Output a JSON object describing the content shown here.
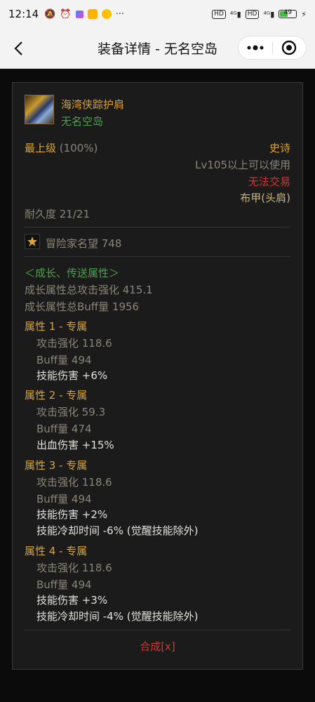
{
  "status_bar": {
    "time": "12:14",
    "battery": "49"
  },
  "header": {
    "title": "装备详情 - 无名空岛"
  },
  "item": {
    "name": "海湾侠踪护肩",
    "source": "无名空岛",
    "grade_label": "最上级",
    "grade_pct": "(100%)",
    "rarity": "史诗",
    "level_req": "Lv105以上可以使用",
    "trade": "无法交易",
    "type": "布甲(头肩)",
    "durability": "耐久度 21/21",
    "fame": "冒险家名望 748"
  },
  "growth": {
    "header": "＜成长、传送属性＞",
    "total_attack": "成长属性总攻击强化 415.1",
    "total_buff": "成长属性总Buff量 1956"
  },
  "attributes": [
    {
      "title": "属性 1 - 专属",
      "attack": "攻击强化   118.6",
      "buff": "Buff量   494",
      "effects": [
        "技能伤害 +6%"
      ]
    },
    {
      "title": "属性 2 - 专属",
      "attack": "攻击强化   59.3",
      "buff": "Buff量   474",
      "effects": [
        "出血伤害 +15%"
      ]
    },
    {
      "title": "属性 3 - 专属",
      "attack": "攻击强化   118.6",
      "buff": "Buff量   494",
      "effects": [
        "技能伤害 +2%",
        "技能冷却时间 -6% (觉醒技能除外)"
      ]
    },
    {
      "title": "属性 4 - 专属",
      "attack": "攻击强化   118.6",
      "buff": "Buff量   494",
      "effects": [
        "技能伤害 +3%",
        "技能冷却时间 -4% (觉醒技能除外)"
      ]
    }
  ],
  "compose_label": "合成[x]",
  "colors": {
    "gold": "#d9a53a",
    "green": "#49a449",
    "red": "#cc3a33",
    "tan": "#c9b37a",
    "grey": "#8a8576"
  }
}
